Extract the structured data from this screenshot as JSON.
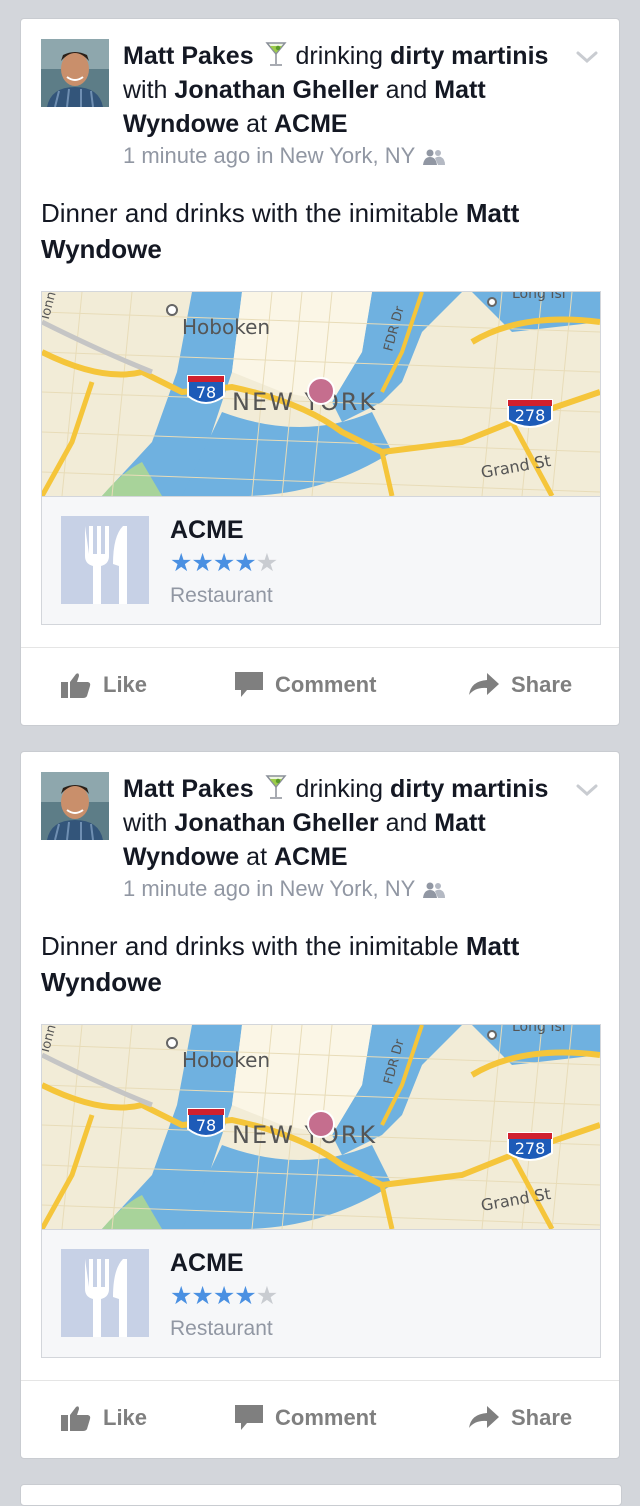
{
  "posts": [
    {
      "author": "Matt Pakes",
      "activity_verb": "drinking",
      "activity_object": "dirty martinis",
      "with_word": "with",
      "friend1": "Jonathan Gheller",
      "and_word": "and",
      "friend2": "Matt Wyndowe",
      "at_word": "at",
      "place": "ACME",
      "meta": "1 minute ago in New York, NY",
      "text_prefix": "Dinner and drinks with the inimitable",
      "text_mention": "Matt Wyndowe",
      "map": {
        "label_hoboken": "Hoboken",
        "label_city": "NEW YORK",
        "label_fdr": "FDR Dr",
        "label_grand": "Grand St",
        "shield_78": "78",
        "shield_278": "278",
        "label_tonn": "Tonn",
        "label_long": "Long Isl"
      },
      "place_card": {
        "name": "ACME",
        "rating": 4,
        "max_rating": 5,
        "category": "Restaurant"
      },
      "actions": {
        "like": "Like",
        "comment": "Comment",
        "share": "Share"
      }
    },
    {
      "author": "Matt Pakes",
      "activity_verb": "drinking",
      "activity_object": "dirty martinis",
      "with_word": "with",
      "friend1": "Jonathan Gheller",
      "and_word": "and",
      "friend2": "Matt Wyndowe",
      "at_word": "at",
      "place": "ACME",
      "meta": "1 minute ago in New York, NY",
      "text_prefix": "Dinner and drinks with the inimitable",
      "text_mention": "Matt Wyndowe",
      "map": {
        "label_hoboken": "Hoboken",
        "label_city": "NEW YORK",
        "label_fdr": "FDR Dr",
        "label_grand": "Grand St",
        "shield_78": "78",
        "shield_278": "278",
        "label_tonn": "Tonn",
        "label_long": "Long Isl"
      },
      "place_card": {
        "name": "ACME",
        "rating": 4,
        "max_rating": 5,
        "category": "Restaurant"
      },
      "actions": {
        "like": "Like",
        "comment": "Comment",
        "share": "Share"
      }
    }
  ],
  "colors": {
    "background": "#d3d6db",
    "star": "#4a90e2",
    "action": "#7f7f7f",
    "meta": "#9197a3",
    "water": "#6fb1e0",
    "road": "#f5c53a"
  }
}
